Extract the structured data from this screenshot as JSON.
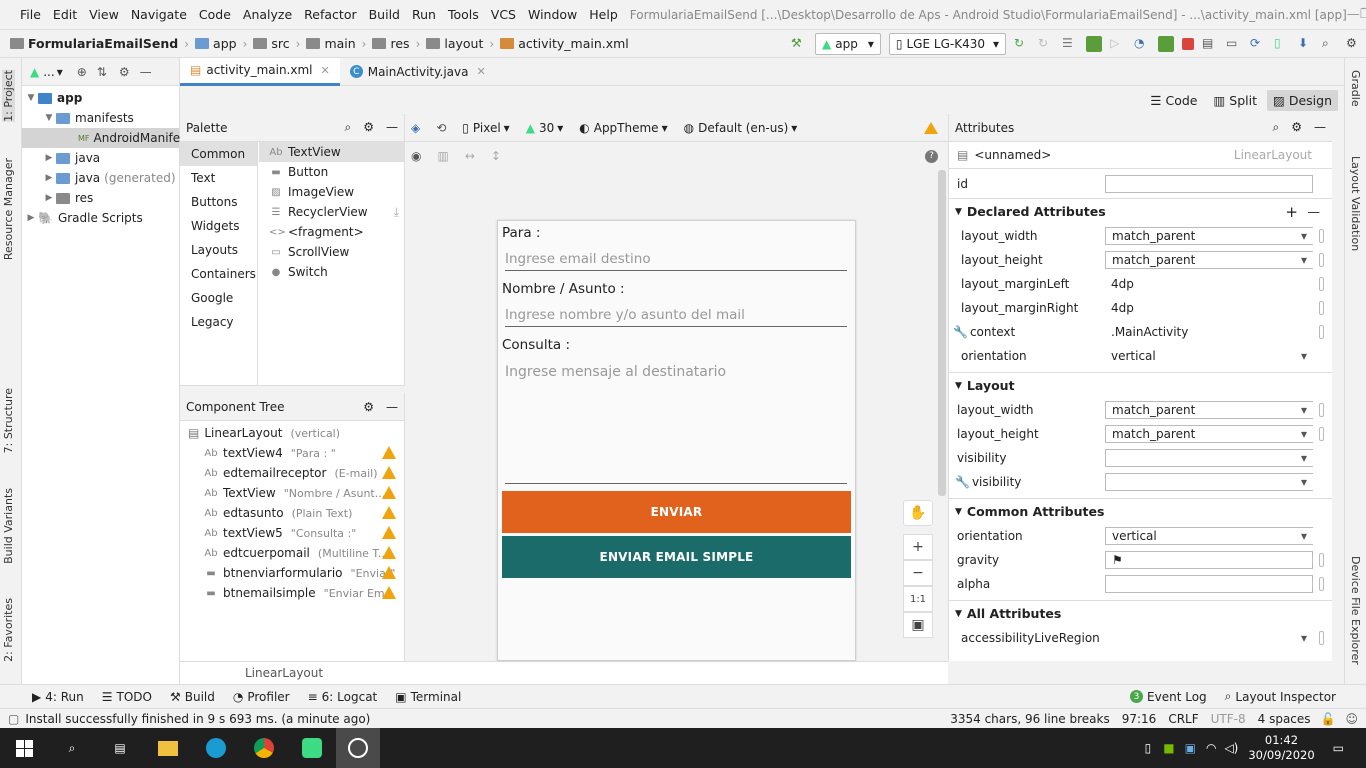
{
  "menu": {
    "items": [
      "File",
      "Edit",
      "View",
      "Navigate",
      "Code",
      "Analyze",
      "Refactor",
      "Build",
      "Run",
      "Tools",
      "VCS",
      "Window",
      "Help"
    ],
    "title": "FormulariaEmailSend [...\\Desktop\\Desarrollo de Aps - Android Studio\\FormulariaEmailSend] - ...\\activity_main.xml [app]"
  },
  "nav": {
    "crumbs": [
      "FormulariaEmailSend",
      "app",
      "src",
      "main",
      "res",
      "layout",
      "activity_main.xml"
    ],
    "run_config": "app",
    "device": "LGE LG-K430"
  },
  "left_tabs": [
    "1: Project",
    "Resource Manager",
    "7: Structure",
    "Build Variants",
    "2: Favorites"
  ],
  "right_tabs": [
    "Gradle",
    "Layout Validation",
    "Device File Explorer"
  ],
  "project": {
    "header": "...",
    "tree": [
      {
        "label": "app",
        "level": 0,
        "expanded": true
      },
      {
        "label": "manifests",
        "level": 1,
        "expanded": true
      },
      {
        "label": "AndroidManifest.xml",
        "level": 2,
        "selected": true
      },
      {
        "label": "java",
        "level": 1
      },
      {
        "label": "java",
        "suffix": "(generated)",
        "level": 1
      },
      {
        "label": "res",
        "level": 1
      },
      {
        "label": "Gradle Scripts",
        "level": 0
      }
    ]
  },
  "editor_tabs": [
    {
      "label": "activity_main.xml",
      "active": true
    },
    {
      "label": "MainActivity.java",
      "active": false
    }
  ],
  "view_modes": [
    "Code",
    "Split",
    "Design"
  ],
  "palette": {
    "title": "Palette",
    "categories": [
      "Common",
      "Text",
      "Buttons",
      "Widgets",
      "Layouts",
      "Containers",
      "Google",
      "Legacy"
    ],
    "items": [
      {
        "icon": "Ab",
        "label": "TextView"
      },
      {
        "icon": "▬",
        "label": "Button"
      },
      {
        "icon": "▨",
        "label": "ImageView"
      },
      {
        "icon": "☰",
        "label": "RecyclerView"
      },
      {
        "icon": "<>",
        "label": "<fragment>"
      },
      {
        "icon": "▭",
        "label": "ScrollView"
      },
      {
        "icon": "●",
        "label": "Switch"
      }
    ]
  },
  "component_tree": {
    "title": "Component Tree",
    "root": {
      "label": "LinearLayout",
      "sub": "(vertical)"
    },
    "children": [
      {
        "icon": "Ab",
        "label": "textView4",
        "sub": "\"Para : \""
      },
      {
        "icon": "Ab",
        "label": "edtemailreceptor",
        "sub": "(E-mail)"
      },
      {
        "icon": "Ab",
        "label": "TextView",
        "sub": "\"Nombre / Asunt..."
      },
      {
        "icon": "Ab",
        "label": "edtasunto",
        "sub": "(Plain Text)"
      },
      {
        "icon": "Ab",
        "label": "textView5",
        "sub": "\"Consulta :\""
      },
      {
        "icon": "Ab",
        "label": "edtcuerpomail",
        "sub": "(Multiline T..."
      },
      {
        "icon": "▬",
        "label": "btnenviarformulario",
        "sub": "\"Enviar\""
      },
      {
        "icon": "▬",
        "label": "btnemailsimple",
        "sub": "\"Enviar Em..."
      }
    ]
  },
  "design_toolbar": {
    "device": "Pixel",
    "api": "30",
    "theme": "AppTheme",
    "locale": "Default (en-us)"
  },
  "preview": {
    "label_para": "Para :",
    "hint_email": "Ingrese email destino",
    "label_nombre": "Nombre / Asunto :",
    "hint_nombre": "Ingrese nombre y/o asunto del mail",
    "label_consulta": "Consulta :",
    "hint_consulta": "Ingrese mensaje al destinatario",
    "btn_enviar": "ENVIAR",
    "btn_simple": "ENVIAR EMAIL SIMPLE",
    "btn_enviar_color": "#e1621c",
    "btn_simple_color": "#1b6b6b"
  },
  "zoom": {
    "one_to_one": "1:1"
  },
  "status_crumb": "LinearLayout",
  "attributes": {
    "title": "Attributes",
    "component": "<unnamed>",
    "component_type": "LinearLayout",
    "id_label": "id",
    "sections": {
      "declared": "Declared Attributes",
      "layout": "Layout",
      "common": "Common Attributes",
      "all": "All Attributes"
    },
    "declared": [
      {
        "name": "layout_width",
        "value": "match_parent",
        "dropdown": true
      },
      {
        "name": "layout_height",
        "value": "match_parent",
        "dropdown": true
      },
      {
        "name": "layout_marginLeft",
        "value": "4dp"
      },
      {
        "name": "layout_marginRight",
        "value": "4dp"
      },
      {
        "name": "context",
        "value": ".MainActivity",
        "tool": true
      },
      {
        "name": "orientation",
        "value": "vertical",
        "dropdown": true
      }
    ],
    "layout": [
      {
        "name": "layout_width",
        "value": "match_parent",
        "dropdown": true
      },
      {
        "name": "layout_height",
        "value": "match_parent",
        "dropdown": true
      },
      {
        "name": "visibility",
        "value": "",
        "dropdown": true
      },
      {
        "name": "visibility",
        "value": "",
        "dropdown": true,
        "tool": true
      }
    ],
    "common": [
      {
        "name": "orientation",
        "value": "vertical",
        "dropdown": true
      },
      {
        "name": "gravity",
        "value": "⚑"
      },
      {
        "name": "alpha",
        "value": ""
      }
    ],
    "all": [
      {
        "name": "accessibilityLiveRegion",
        "value": "",
        "dropdown": true
      }
    ]
  },
  "bottom_tools": [
    "4: Run",
    "TODO",
    "Build",
    "Profiler",
    "6: Logcat",
    "Terminal"
  ],
  "bottom_right_tools": [
    "Event Log",
    "Layout Inspector"
  ],
  "status": {
    "message": "Install successfully finished in 9 s 693 ms. (a minute ago)",
    "chars": "3354 chars, 96 line breaks",
    "pos": "97:16",
    "crlf": "CRLF",
    "enc": "UTF-8",
    "indent": "4 spaces"
  },
  "taskbar": {
    "time": "01:42",
    "date": "30/09/2020"
  }
}
